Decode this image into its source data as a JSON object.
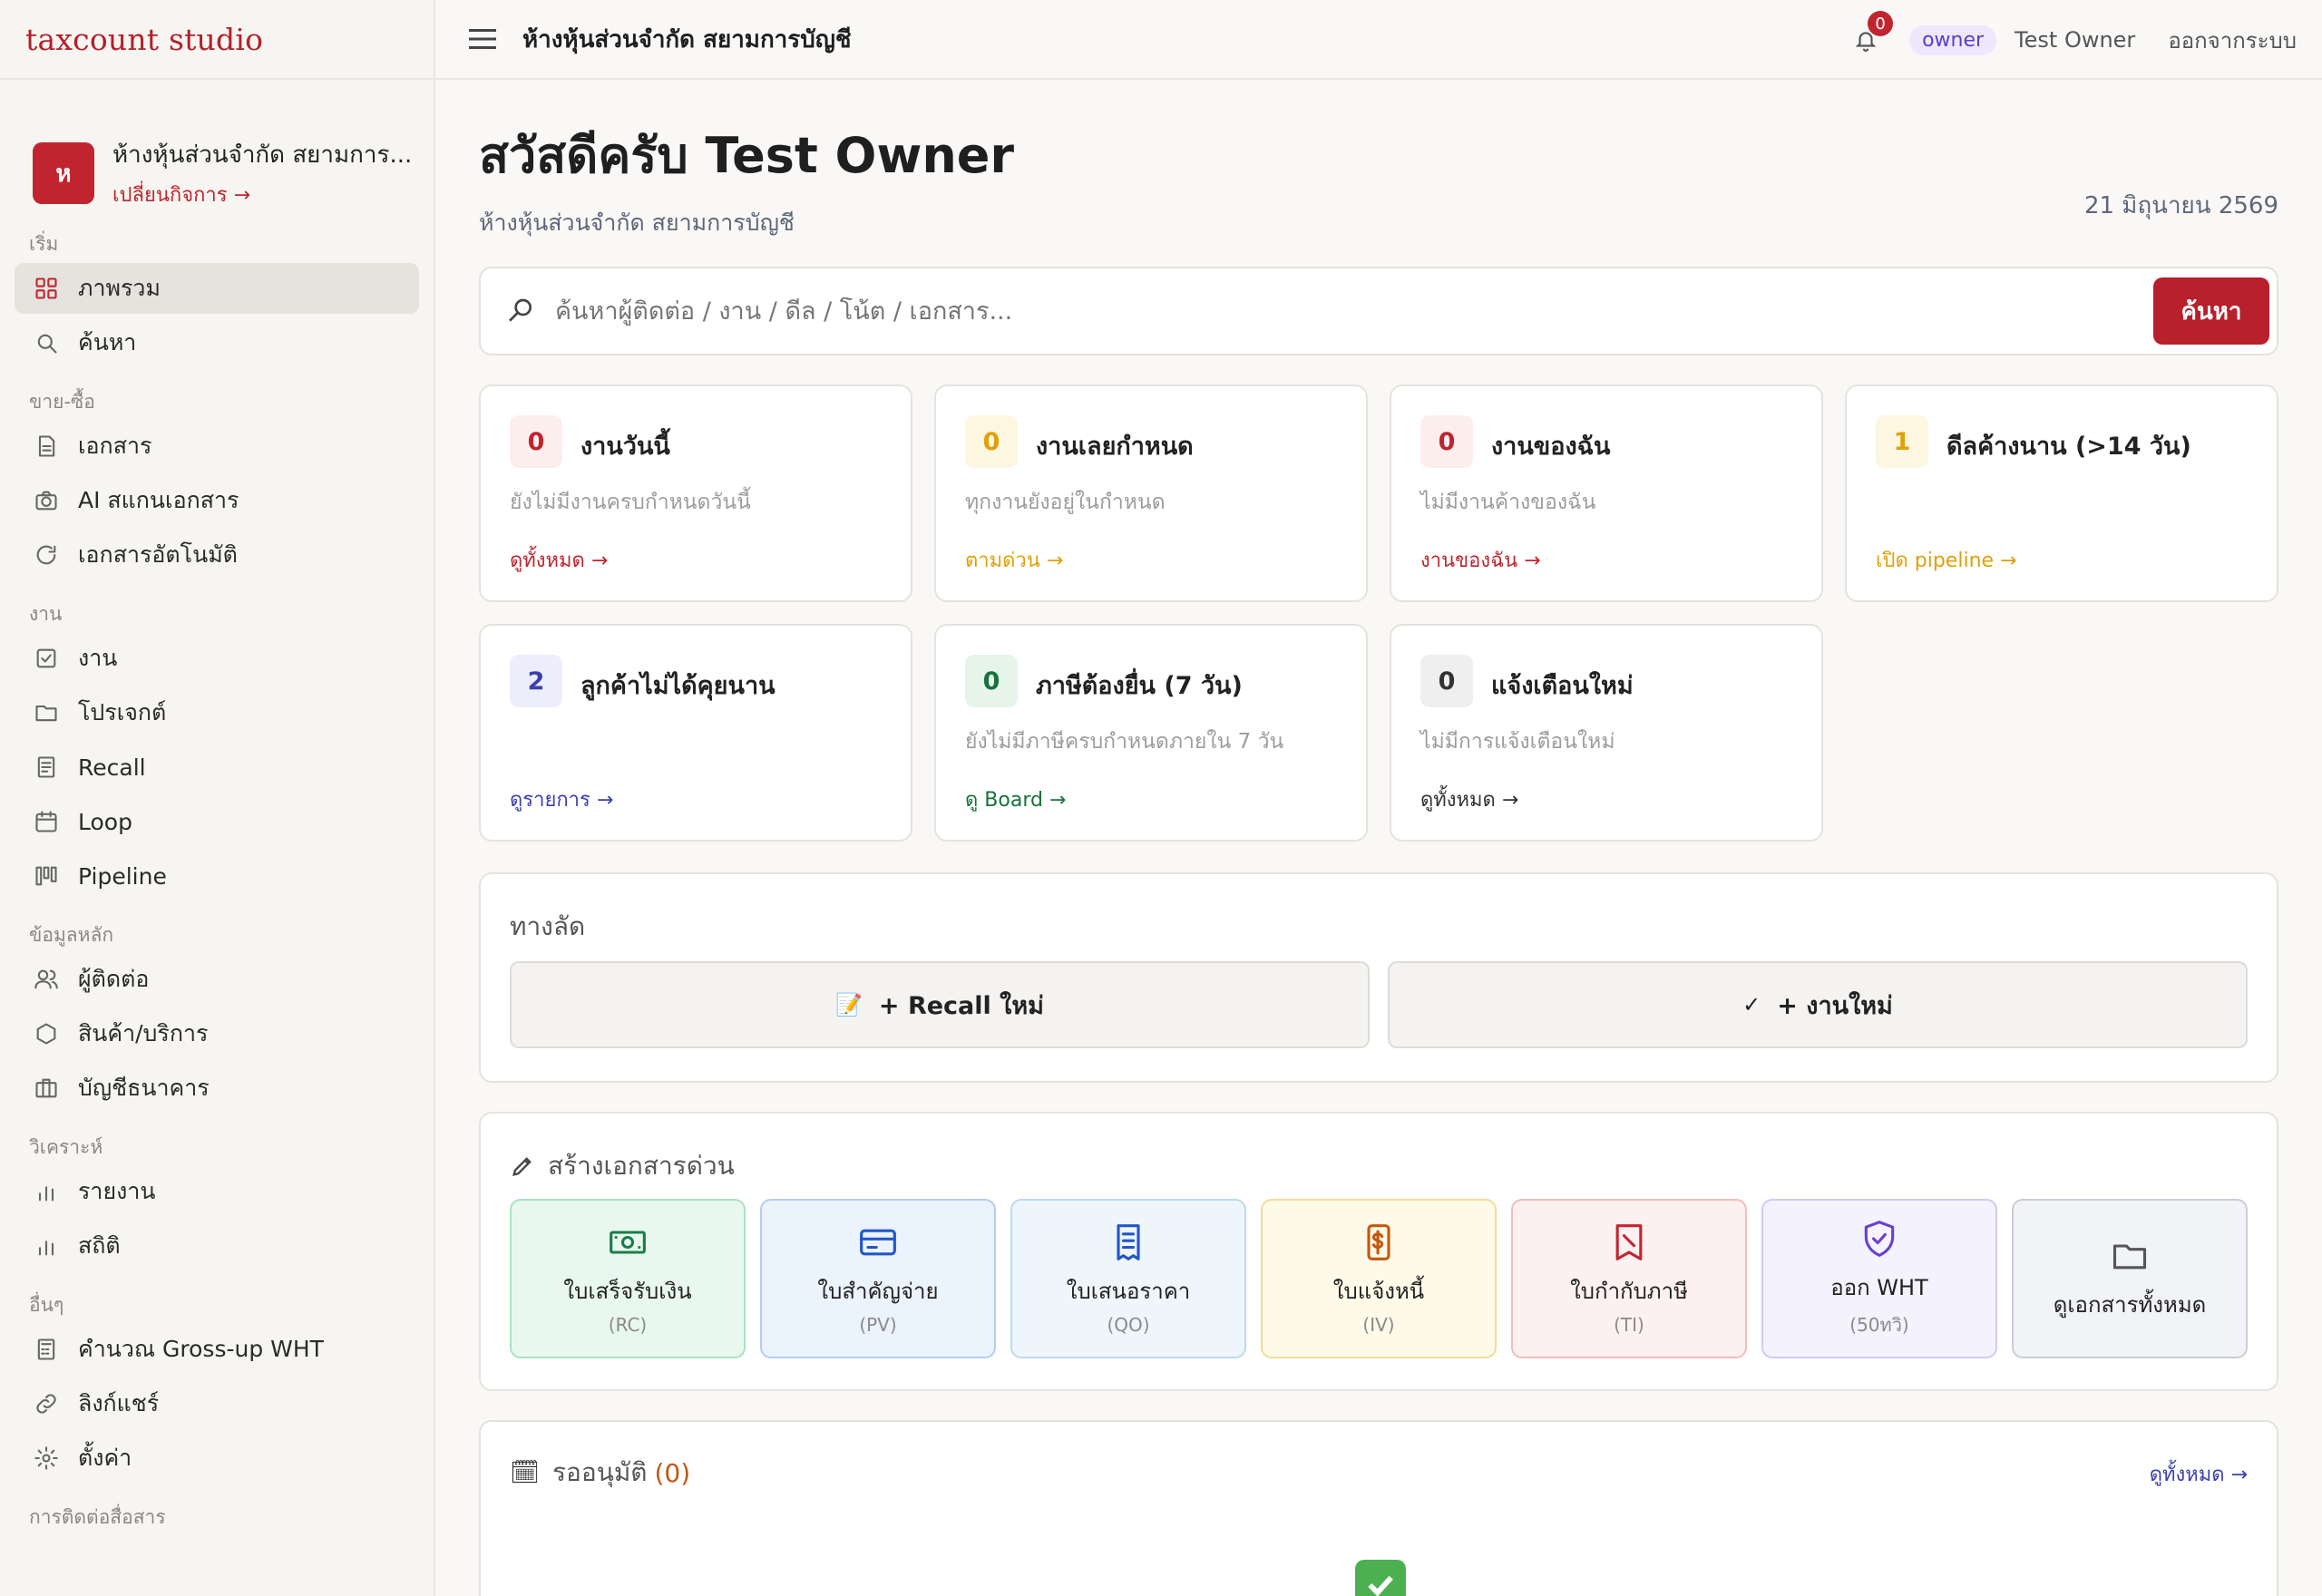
{
  "brand": "taxcount studio",
  "business": {
    "initial": "ห",
    "name": "ห้างหุ้นส่วนจำกัด สยามการ...",
    "switch_label": "เปลี่ยนกิจการ →"
  },
  "sidebar": {
    "sections": [
      {
        "label": "เริ่ม",
        "items": [
          {
            "label": "ภาพรวม",
            "icon": "grid-icon",
            "active": true
          },
          {
            "label": "ค้นหา",
            "icon": "search-icon"
          }
        ]
      },
      {
        "label": "ขาย-ซื้อ",
        "items": [
          {
            "label": "เอกสาร",
            "icon": "document-icon"
          },
          {
            "label": "AI สแกนเอกสาร",
            "icon": "camera-icon"
          },
          {
            "label": "เอกสารอัตโนมัติ",
            "icon": "refresh-icon"
          }
        ]
      },
      {
        "label": "งาน",
        "items": [
          {
            "label": "งาน",
            "icon": "checkbox-icon"
          },
          {
            "label": "โปรเจกต์",
            "icon": "folder-icon"
          },
          {
            "label": "Recall",
            "icon": "note-icon"
          },
          {
            "label": "Loop",
            "icon": "calendar-icon"
          },
          {
            "label": "Pipeline",
            "icon": "kanban-icon"
          }
        ]
      },
      {
        "label": "ข้อมูลหลัก",
        "items": [
          {
            "label": "ผู้ติดต่อ",
            "icon": "users-icon"
          },
          {
            "label": "สินค้า/บริการ",
            "icon": "box-icon"
          },
          {
            "label": "บัญชีธนาคาร",
            "icon": "bank-icon"
          }
        ]
      },
      {
        "label": "วิเคราะห์",
        "items": [
          {
            "label": "รายงาน",
            "icon": "bar-chart-icon"
          },
          {
            "label": "สถิติ",
            "icon": "bar-chart-icon"
          }
        ]
      },
      {
        "label": "อื่นๆ",
        "items": [
          {
            "label": "คำนวณ Gross-up WHT",
            "icon": "calculator-icon"
          },
          {
            "label": "ลิงก์แชร์",
            "icon": "link-icon"
          },
          {
            "label": "ตั้งค่า",
            "icon": "gear-icon"
          }
        ]
      },
      {
        "label": "การติดต่อสื่อสาร",
        "items": []
      }
    ]
  },
  "topbar": {
    "title": "ห้างหุ้นส่วนจำกัด สยามการบัญชี",
    "notif_count": "0",
    "role": "owner",
    "user": "Test Owner",
    "logout": "ออกจากระบบ"
  },
  "header": {
    "greeting": "สวัสดีครับ Test Owner",
    "subtitle": "ห้างหุ้นส่วนจำกัด สยามการบัญชี",
    "date": "21 มิถุนายน 2569"
  },
  "search": {
    "placeholder": "ค้นหาผู้ติดต่อ / งาน / ดีล / โน้ต / เอกสาร...",
    "button": "ค้นหา"
  },
  "stats": [
    {
      "count": "0",
      "title": "งานวันนี้",
      "desc": "ยังไม่มีงานครบกำหนดวันนี้",
      "link": "ดูทั้งหมด →",
      "color": "#c0252f",
      "bg": "#fdeeee"
    },
    {
      "count": "0",
      "title": "งานเลยกำหนด",
      "desc": "ทุกงานยังอยู่ในกำหนด",
      "link": "ตามด่วน →",
      "color": "#e0a008",
      "bg": "#fdf6e0"
    },
    {
      "count": "0",
      "title": "งานของฉัน",
      "desc": "ไม่มีงานค้างของฉัน",
      "link": "งานของฉัน →",
      "color": "#c0252f",
      "bg": "#fdeeee"
    },
    {
      "count": "1",
      "title": "ดีลค้างนาน (>14 วัน)",
      "desc": "",
      "link": "เปิด pipeline →",
      "color": "#e0a008",
      "bg": "#fdf6e0"
    },
    {
      "count": "2",
      "title": "ลูกค้าไม่ได้คุยนาน",
      "desc": "",
      "link": "ดูรายการ →",
      "color": "#3b3fb0",
      "bg": "#eceefc"
    },
    {
      "count": "0",
      "title": "ภาษีต้องยื่น (7 วัน)",
      "desc": "ยังไม่มีภาษีครบกำหนดภายใน 7 วัน",
      "link": "ดู Board →",
      "color": "#17733a",
      "bg": "#e6f4ea"
    },
    {
      "count": "0",
      "title": "แจ้งเตือนใหม่",
      "desc": "ไม่มีการแจ้งเตือนใหม่",
      "link": "ดูทั้งหมด →",
      "color": "#333333",
      "bg": "#efefef"
    }
  ],
  "shortcuts": {
    "title": "ทางลัด",
    "recall": "+ Recall ใหม่",
    "recall_icon": "📝",
    "task": "+ งานใหม่",
    "task_icon": "✓"
  },
  "quick_docs": {
    "title": "สร้างเอกสารด่วน",
    "items": [
      {
        "label": "ใบเสร็จรับเงิน",
        "code": "(RC)",
        "icon": "cash-icon",
        "color": "#1a7d4a",
        "bg": "#e9f8ef",
        "border": "#a8e2c1"
      },
      {
        "label": "ใบสำคัญจ่าย",
        "code": "(PV)",
        "icon": "credit-card-icon",
        "color": "#2356c7",
        "bg": "#ebf3fd",
        "border": "#b4cdf2"
      },
      {
        "label": "ใบเสนอราคา",
        "code": "(QO)",
        "icon": "receipt-icon",
        "color": "#2356c7",
        "bg": "#eef6fc",
        "border": "#bcd9ee"
      },
      {
        "label": "ใบแจ้งหนี้",
        "code": "(IV)",
        "icon": "invoice-icon",
        "color": "#c4570e",
        "bg": "#fefae8",
        "border": "#f2dc98"
      },
      {
        "label": "ใบกำกับภาษี",
        "code": "(TI)",
        "icon": "tax-invoice-icon",
        "color": "#c0252f",
        "bg": "#fdf0f0",
        "border": "#f2bcbc"
      },
      {
        "label": "ออก WHT",
        "code": "(50ทวิ)",
        "icon": "shield-icon",
        "color": "#6b3fd0",
        "bg": "#f4f2fd",
        "border": "#d2c9f2"
      },
      {
        "label": "ดูเอกสารทั้งหมด",
        "code": "",
        "icon": "folder-icon",
        "color": "#555555",
        "bg": "#f1f3f6",
        "border": "#c9ced6"
      }
    ]
  },
  "approvals": {
    "title": "รออนุมัติ",
    "count": "(0)",
    "link": "ดูทั้งหมด →",
    "icon": "🗓"
  }
}
